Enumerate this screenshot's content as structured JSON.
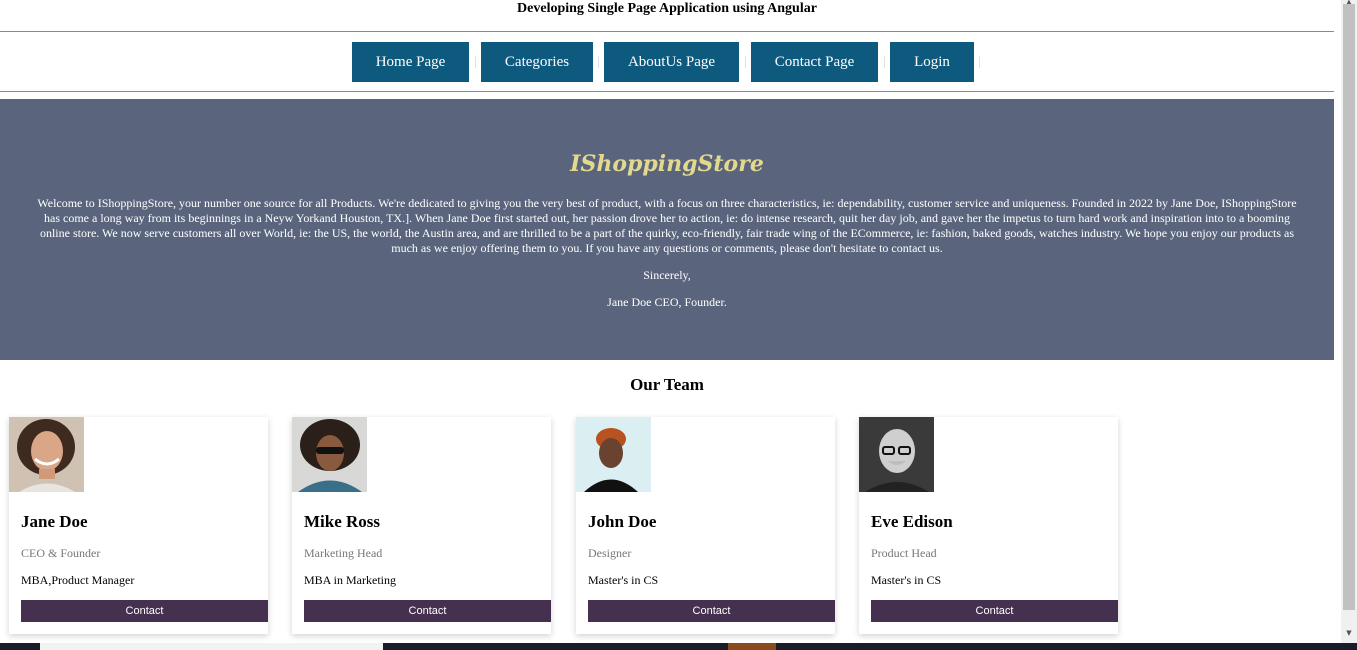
{
  "header": {
    "title": "Developing Single Page Application using Angular"
  },
  "nav": {
    "items": [
      {
        "label": "Home Page"
      },
      {
        "label": "Categories"
      },
      {
        "label": "AboutUs Page"
      },
      {
        "label": "Contact Page"
      },
      {
        "label": "Login"
      }
    ]
  },
  "hero": {
    "title": "IShoppingStore",
    "text": "Welcome to IShoppingStore, your number one source for all Products. We're dedicated to giving you the very best of product, with a focus on three characteristics, ie: dependability, customer service and uniqueness. Founded in 2022 by Jane Doe, IShoppingStore has come a long way from its beginnings in a Neyw Yorkand Houston, TX.]. When Jane Doe first started out, her passion drove her to action, ie: do intense research, quit her day job, and gave her the impetus to turn hard work and inspiration into to a booming online store. We now serve customers all over World, ie: the US, the world, the Austin area, and are thrilled to be a part of the quirky, eco-friendly, fair trade wing of the ECommerce, ie: fashion, baked goods, watches industry. We hope you enjoy our products as much as we enjoy offering them to you. If you have any questions or comments, please don't hesitate to contact us.",
    "sign_off": "Sincerely,",
    "signature": "Jane Doe CEO, Founder."
  },
  "team": {
    "heading": "Our Team",
    "members": [
      {
        "name": "Jane Doe",
        "role": "CEO & Founder",
        "degree": "MBA,Product Manager",
        "button": "Contact"
      },
      {
        "name": "Mike Ross",
        "role": "Marketing Head",
        "degree": "MBA in Marketing",
        "button": "Contact"
      },
      {
        "name": "John Doe",
        "role": "Designer",
        "degree": "Master's in CS",
        "button": "Contact"
      },
      {
        "name": "Eve Edison",
        "role": "Product Head",
        "degree": "Master's in CS",
        "button": "Contact"
      }
    ]
  },
  "colors": {
    "nav_button": "#0e5a7e",
    "hero_background": "#5a657d",
    "hero_title": "#e3d98e",
    "contact_button": "#46304f"
  }
}
